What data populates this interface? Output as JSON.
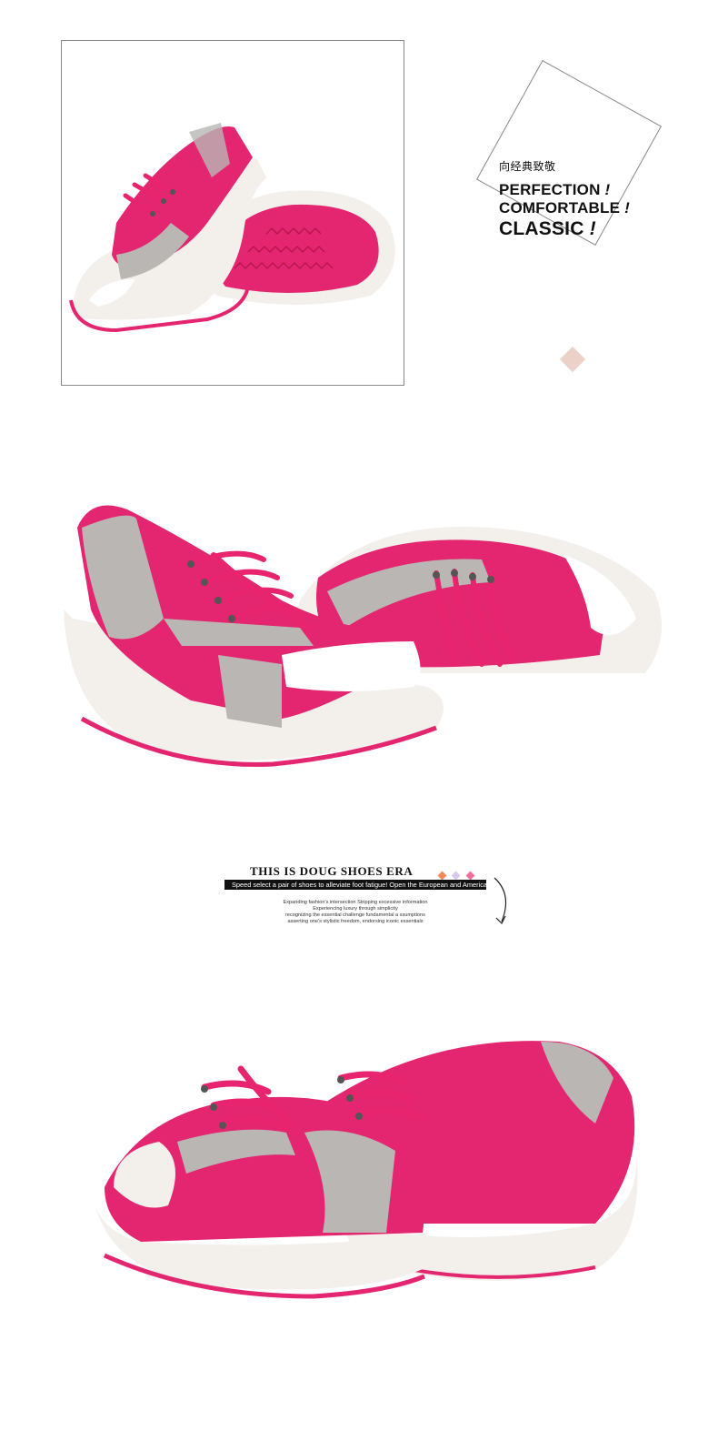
{
  "slogan": {
    "chinese": "向经典致敬",
    "line1": "PERFECTION",
    "line2": "COMFORTABLE",
    "line3": "CLASSIC",
    "mark": "!"
  },
  "banner": {
    "title": "THIS IS DOUG SHOES ERA",
    "strip": "Speed select a pair of shoes to alleviate foot fatigue! Open the European and American life",
    "sub1": "Expanding fashion's intersection Stripping excessive information",
    "sub2": "Experiencing luxury through simplicity",
    "sub3": "recognizing the essential challenge fundamental a ssumptions",
    "sub4": "asserting one's stylistic freedom, endorsing iconic essentials"
  },
  "colors": {
    "accent_pink": "#e8246f",
    "suede_grey": "#b9b6b4",
    "sole_white": "#f3f0ec",
    "diamond": "#ecd1c8",
    "dot_orange": "#f08a5d",
    "dot_lilac": "#d9c7f0",
    "dot_pink": "#ef6f9f"
  },
  "images": {
    "photo1": "pink-mesh-wedge-sandals-pair-top-and-sole-icon",
    "photo2": "pink-mesh-wedge-sandals-pair-side-icon",
    "photo3": "pink-mesh-wedge-sandals-pair-front-icon"
  }
}
